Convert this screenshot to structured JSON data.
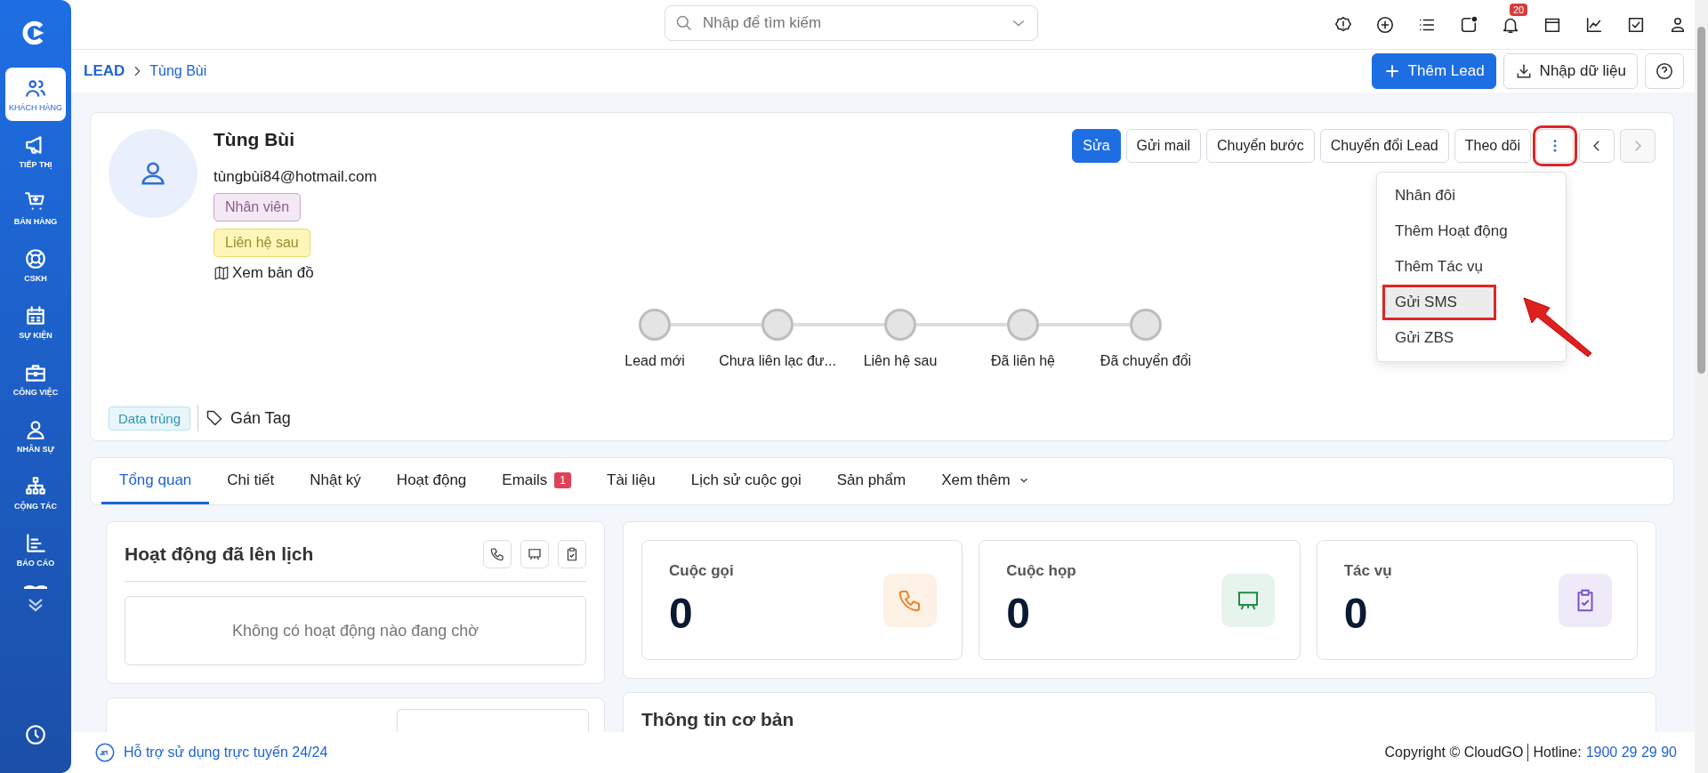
{
  "sidebar": {
    "items": [
      {
        "label": "KHÁCH HÀNG",
        "selected": true
      },
      {
        "label": "TIẾP THỊ",
        "selected": false
      },
      {
        "label": "BÁN HÀNG",
        "selected": false
      },
      {
        "label": "CSKH",
        "selected": false
      },
      {
        "label": "SỰ KIỆN",
        "selected": false
      },
      {
        "label": "CÔNG VIỆC",
        "selected": false
      },
      {
        "label": "NHÂN SỰ",
        "selected": false
      },
      {
        "label": "CỘNG TÁC",
        "selected": false
      },
      {
        "label": "BÁO CÁO",
        "selected": false
      }
    ]
  },
  "topbar": {
    "search": {
      "placeholder": "Nhập để tìm kiếm"
    },
    "notification_count": "20"
  },
  "breadcrumb": [
    "LEAD",
    "Tùng Bùi"
  ],
  "header_buttons": [
    {
      "label": "Thêm Lead",
      "primary": true
    },
    {
      "label": "Nhập dữ liệu",
      "primary": false
    }
  ],
  "profile": {
    "name": "Tùng Bùi",
    "email": "tùngbùi84@hotmail.com",
    "tags": [
      {
        "label": "Nhân viên",
        "color": "#f5e8f5"
      },
      {
        "label": "Liên hệ sau",
        "color": "#fdf6b8"
      }
    ],
    "map_link": "Xem bản đồ",
    "duplicate_badge": "Data trùng",
    "assign_tag": "Gán Tag",
    "actions": [
      {
        "label": "Sửa",
        "primary": true
      },
      {
        "label": "Gửi mail",
        "primary": false
      },
      {
        "label": "Chuyển bước",
        "primary": false
      },
      {
        "label": "Chuyển đổi Lead",
        "primary": false
      },
      {
        "label": "Theo dõi",
        "primary": false
      }
    ],
    "more_menu": {
      "expanded": true,
      "items": [
        {
          "label": "Nhân đôi",
          "highlighted": false
        },
        {
          "label": "Thêm Hoạt động",
          "highlighted": false
        },
        {
          "label": "Thêm Tác vụ",
          "highlighted": false
        },
        {
          "label": "Gửi SMS",
          "highlighted": true
        },
        {
          "label": "Gửi ZBS",
          "highlighted": false
        }
      ]
    },
    "stages": [
      {
        "label": "Lead mới"
      },
      {
        "label": "Chưa liên lạc đư..."
      },
      {
        "label": "Liên hệ sau"
      },
      {
        "label": "Đã liên hệ"
      },
      {
        "label": "Đã chuyển đổi"
      }
    ]
  },
  "tabs": [
    {
      "label": "Tổng quan",
      "selected": true
    },
    {
      "label": "Chi tiết",
      "selected": false
    },
    {
      "label": "Nhật ký",
      "selected": false
    },
    {
      "label": "Hoạt động",
      "selected": false
    },
    {
      "label": "Emails",
      "selected": false,
      "badge": "1"
    },
    {
      "label": "Tài liệu",
      "selected": false
    },
    {
      "label": "Lịch sử cuộc gọi",
      "selected": false
    },
    {
      "label": "Sản phẩm",
      "selected": false
    },
    {
      "label": "Xem thêm",
      "selected": false
    }
  ],
  "scheduled": {
    "title": "Hoạt động đã lên lịch",
    "empty": "Không có hoạt động nào đang chờ"
  },
  "stats": [
    {
      "label": "Cuộc gọi",
      "value": "0",
      "color": "#fdf0e4"
    },
    {
      "label": "Cuộc họp",
      "value": "0",
      "color": "#e6f4ec"
    },
    {
      "label": "Tác vụ",
      "value": "0",
      "color": "#efeafa"
    }
  ],
  "basic_info": {
    "title": "Thông tin cơ bản"
  },
  "footer": {
    "support": "Hỗ trợ sử dụng trực tuyến 24/24",
    "copyright": "Copyright © CloudGO",
    "hotline_label": "Hotline:",
    "hotline": "1900 29 29 90"
  }
}
